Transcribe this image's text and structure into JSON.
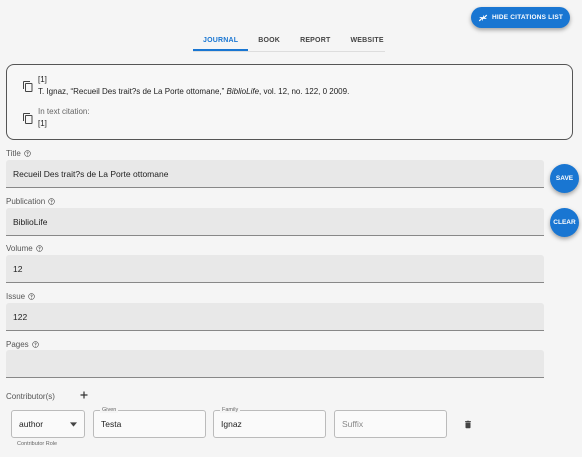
{
  "header": {
    "hide_citations_label": "HIDE CITATIONS LIST"
  },
  "tabs": [
    {
      "label": "JOURNAL",
      "active": true
    },
    {
      "label": "BOOK",
      "active": false
    },
    {
      "label": "REPORT",
      "active": false
    },
    {
      "label": "WEBSITE",
      "active": false
    }
  ],
  "citation": {
    "number": "[1]",
    "text_prefix": "T. Ignaz, “Recueil Des trait?s de La Porte ottomane,” ",
    "journal_italic": "BiblioLife",
    "text_suffix": ", vol. 12, no. 122, 0 2009.",
    "in_text_label": "In text citation:",
    "in_text_value": "[1]"
  },
  "fields": {
    "title": {
      "label": "Title",
      "value": "Recueil Des trait?s de La Porte ottomane"
    },
    "publication": {
      "label": "Publication",
      "value": "BiblioLife"
    },
    "volume": {
      "label": "Volume",
      "value": "12"
    },
    "issue": {
      "label": "Issue",
      "value": "122"
    },
    "pages": {
      "label": "Pages",
      "value": ""
    }
  },
  "buttons": {
    "save": "SAVE",
    "clear": "CLEAR"
  },
  "contributors": {
    "label": "Contributor(s)",
    "items": [
      {
        "role": "author",
        "role_label": "Contributor Role",
        "given_label": "Given",
        "given": "Testa",
        "family_label": "Family",
        "family": "Ignaz",
        "suffix_placeholder": "Suffix"
      }
    ]
  },
  "colors": {
    "accent": "#1976d2"
  },
  "icons": [
    "compress-icon",
    "copy-icon",
    "help-icon",
    "plus-icon",
    "dropdown-arrow-icon",
    "trash-icon"
  ]
}
